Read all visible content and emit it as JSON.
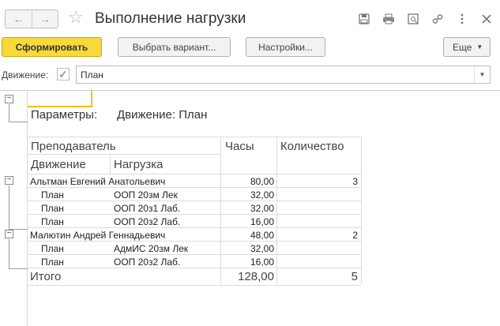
{
  "window": {
    "title": "Выполнение нагрузки"
  },
  "nav": {
    "back": "←",
    "forward": "→"
  },
  "toolbar_icons": [
    "save-icon",
    "print-icon",
    "preview-icon",
    "link-icon",
    "more-vert-icon",
    "close-icon"
  ],
  "buttons": {
    "generate": "Сформировать",
    "choose_variant": "Выбрать вариант...",
    "settings": "Настройки...",
    "more": "Еще"
  },
  "filter": {
    "label": "Движение:",
    "checked": true,
    "value": "План"
  },
  "report": {
    "params_label": "Параметры:",
    "params_value": "Движение: План",
    "headers": {
      "teacher": "Преподаватель",
      "hours": "Часы",
      "count": "Количество",
      "movement": "Движение",
      "load": "Нагрузка"
    },
    "groups": [
      {
        "name": "Альтман Евгений  Анатольевич",
        "hours": "80,00",
        "count": "3",
        "rows": [
          {
            "movement": "План",
            "load": "ООП 20зм Лек",
            "hours": "32,00"
          },
          {
            "movement": "План",
            "load": "ООП 20з1 Лаб.",
            "hours": "32,00"
          },
          {
            "movement": "План",
            "load": "ООП 20з2 Лаб.",
            "hours": "16,00"
          }
        ]
      },
      {
        "name": "Малютин Андрей Геннадьевич",
        "hours": "48,00",
        "count": "2",
        "rows": [
          {
            "movement": "План",
            "load": "АдмИС 20зм Лек",
            "hours": "32,00"
          },
          {
            "movement": "План",
            "load": "ООП 20з2 Лаб.",
            "hours": "16,00"
          }
        ]
      }
    ],
    "total": {
      "label": "Итого",
      "hours": "128,00",
      "count": "5"
    }
  }
}
